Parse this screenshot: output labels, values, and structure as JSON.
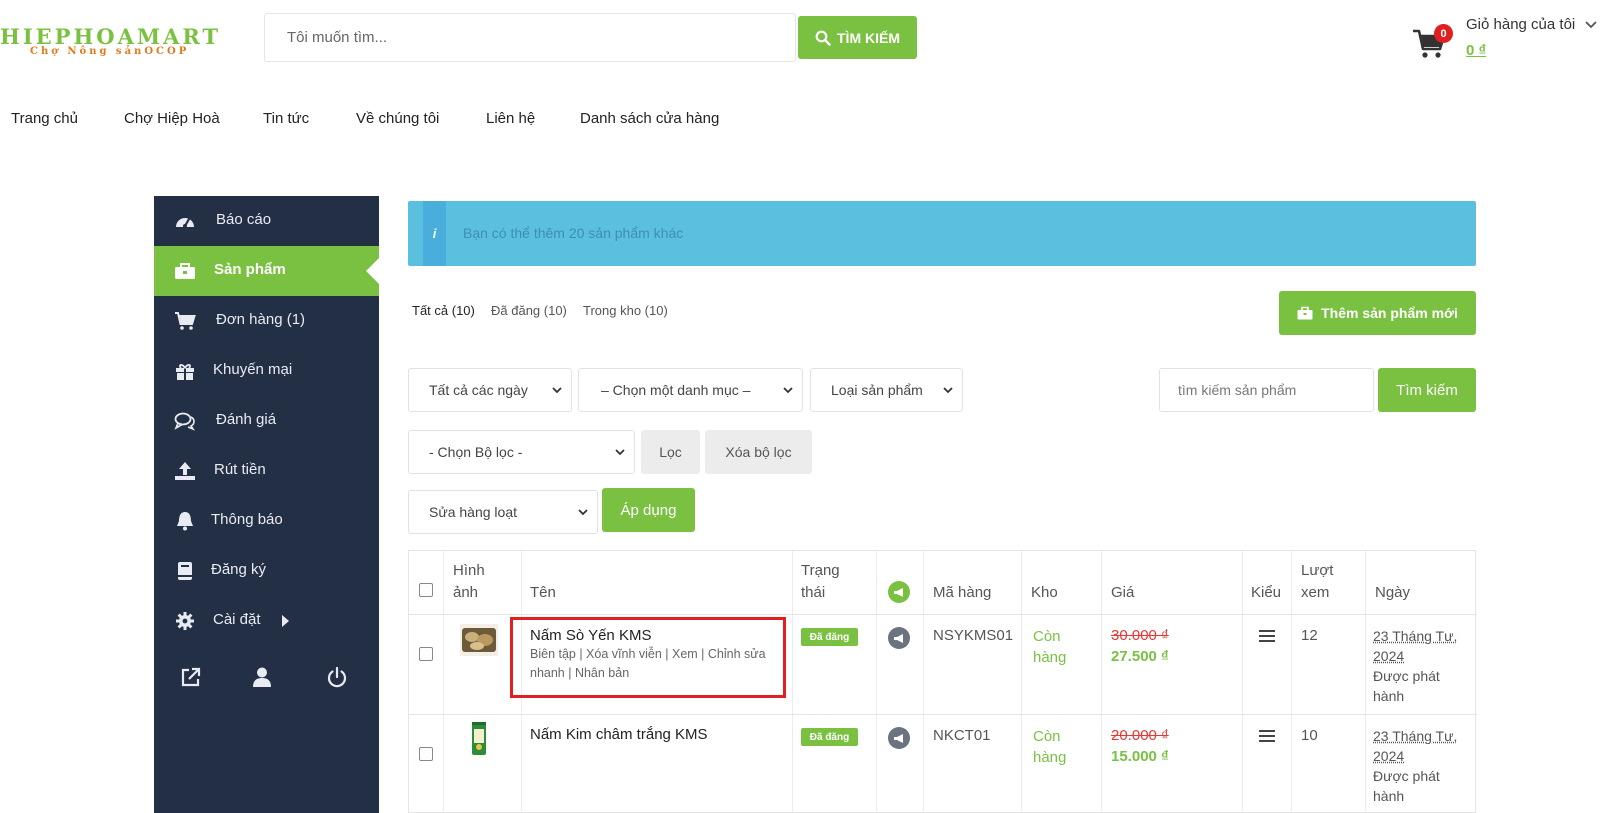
{
  "header": {
    "logo_main": "HIEPHOAMART",
    "logo_sub": "Chợ Nông sảnOCOP",
    "search_placeholder": "Tôi muốn tìm...",
    "search_button": "TÌM KIẾM",
    "cart_count": "0",
    "cart_title": "Giỏ hàng của tôi",
    "cart_total": "0 ₫"
  },
  "nav": [
    "Trang chủ",
    "Chợ Hiệp Hoà",
    "Tin tức",
    "Về chúng tôi",
    "Liên hệ",
    "Danh sách cửa hàng"
  ],
  "sidebar": {
    "items": [
      {
        "label": "Báo cáo",
        "icon": "dashboard-icon"
      },
      {
        "label": "Sản phẩm",
        "icon": "briefcase-icon",
        "active": true
      },
      {
        "label": "Đơn hàng (1)",
        "icon": "cart-icon"
      },
      {
        "label": "Khuyến mại",
        "icon": "gift-icon"
      },
      {
        "label": "Đánh giá",
        "icon": "chat-icon"
      },
      {
        "label": "Rút tiền",
        "icon": "upload-icon"
      },
      {
        "label": "Thông báo",
        "icon": "bell-icon"
      },
      {
        "label": "Đăng ký",
        "icon": "book-icon"
      },
      {
        "label": "Cài đặt",
        "icon": "gear-icon"
      }
    ]
  },
  "alert": {
    "text": "Bạn có thể thêm 20 sản phẩm khác"
  },
  "tabs": [
    "Tất cả (10)",
    "Đã đăng (10)",
    "Trong kho (10)"
  ],
  "add_button": "Thêm sản phẩm mới",
  "filters": {
    "date": "Tất cả các ngày",
    "category": "– Chọn một danh mục –",
    "type": "Loại sản phẩm",
    "search_placeholder": "tìm kiếm sản phẩm",
    "search_button": "Tìm kiếm",
    "filter_select": "- Chọn Bộ lọc -",
    "filter_button": "Lọc",
    "clear_button": "Xóa bộ lọc",
    "bulk_select": "Sửa hàng loạt",
    "apply_button": "Áp dụng"
  },
  "table": {
    "headers": {
      "image_1": "Hình",
      "image_2": "ảnh",
      "name": "Tên",
      "status_1": "Trạng",
      "status_2": "thái",
      "sku": "Mã hàng",
      "stock": "Kho",
      "price": "Giá",
      "type": "Kiểu",
      "views_1": "Lượt",
      "views_2": "xem",
      "date": "Ngày"
    },
    "rows": [
      {
        "name": "Nấm Sò Yến KMS",
        "actions_1": "Biên tập | Xóa vĩnh viễn | Xem | Chỉnh sửa",
        "actions_2": "nhanh | Nhân bản",
        "status": "Đã đăng",
        "sku": "NSYKMS01",
        "stock_1": "Còn",
        "stock_2": "hàng",
        "price_old": "30.000 ₫",
        "price_new": "27.500 ₫",
        "views": "12",
        "date_1": "23 Tháng Tư,",
        "date_2": "2024",
        "date_3": "Được phát",
        "date_4": "hành"
      },
      {
        "name": "Nấm Kim châm trắng KMS",
        "status": "Đã đăng",
        "sku": "NKCT01",
        "stock_1": "Còn",
        "stock_2": "hàng",
        "price_old": "20.000 ₫",
        "price_new": "15.000 ₫",
        "views": "10",
        "date_1": "23 Tháng Tư,",
        "date_2": "2024",
        "date_3": "Được phát",
        "date_4": "hành"
      }
    ]
  },
  "colors": {
    "accent": "#7ac142",
    "sidebar": "#232f45",
    "alert": "#5bc0e0",
    "sale": "#e53935",
    "highlight": "#e02020"
  }
}
